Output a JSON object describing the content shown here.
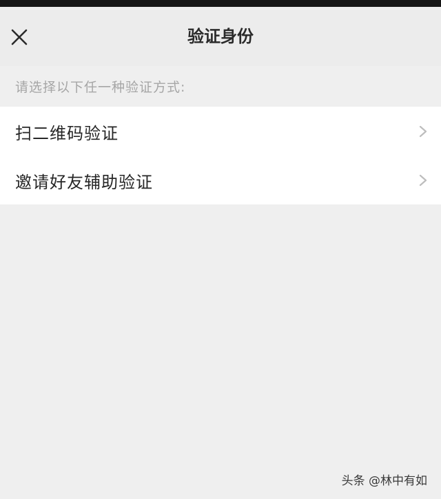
{
  "nav": {
    "title": "验证身份",
    "close_icon": "close-icon"
  },
  "hint": "请选择以下任一种验证方式:",
  "options": [
    {
      "label": "扫二维码验证",
      "icon": "chevron-right-icon"
    },
    {
      "label": "邀请好友辅助验证",
      "icon": "chevron-right-icon"
    }
  ],
  "watermark": "头条 @林中有如",
  "colors": {
    "background": "#efefef",
    "nav_background": "#ececec",
    "row_background": "#ffffff",
    "hint_text": "#a6a6a6",
    "primary_text": "#262626"
  }
}
